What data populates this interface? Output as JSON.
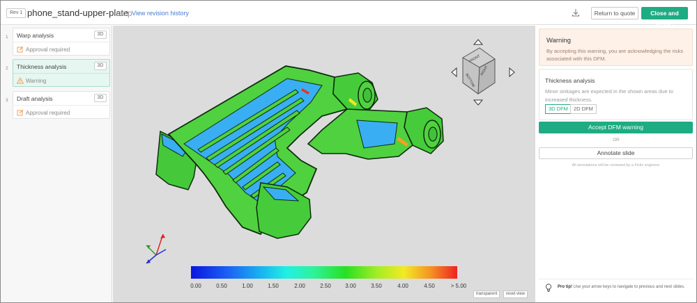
{
  "header": {
    "revision": "Rev 1",
    "file_name": "phone_stand-upper-plate",
    "file_ext": "step",
    "revision_link": "View revision history",
    "return_label": "Return to quote",
    "close_label": "Close and Notify",
    "icons": {
      "download": "download-icon"
    }
  },
  "sidebar": {
    "items": [
      {
        "num": "1",
        "title": "Warp analysis",
        "tag": "3D",
        "status": "Approval required",
        "icon": "edit-icon"
      },
      {
        "num": "2",
        "title": "Thickness analysis",
        "tag": "3D",
        "status": "Warning",
        "icon": "warning-icon",
        "active": true
      },
      {
        "num": "3",
        "title": "Draft analysis",
        "tag": "3D",
        "status": "Approval required",
        "icon": "edit-icon"
      }
    ]
  },
  "viewer": {
    "view_cube": {
      "faces": [
        "FRONT",
        "BOTTOM",
        "RIGHT"
      ]
    },
    "legend": {
      "labels": [
        "0.00",
        "0.50",
        "1.00",
        "1.50",
        "2.00",
        "2.50",
        "3.00",
        "3.50",
        "4.00",
        "4.50",
        "> 5.00"
      ]
    },
    "transparent_label": "transparent",
    "reset_label": "reset view",
    "colors": {
      "accent": "#1fac83",
      "model_base": "#4fd23f",
      "model_thin": "#3aaef2"
    }
  },
  "panel": {
    "warning_title": "Warning",
    "warning_text": "By accepting this warning, you are acknowledging the risks associated with this DFM.",
    "thickness_title": "Thickness analysis",
    "thickness_text": "Minor sinkages are expected in the shown areas due to increased thickness.",
    "dfm_3d": "3D DFM",
    "dfm_2d": "2D DFM",
    "accept_label": "Accept DFM warning",
    "or_label": "OR",
    "annotate_label": "Annotate slide",
    "note": "All annotations will be reviewed by a Fictiv engineer.",
    "tip_bold": "Pro tip!",
    "tip_text": "Use your arrow keys to navigate to previous and next slides."
  }
}
